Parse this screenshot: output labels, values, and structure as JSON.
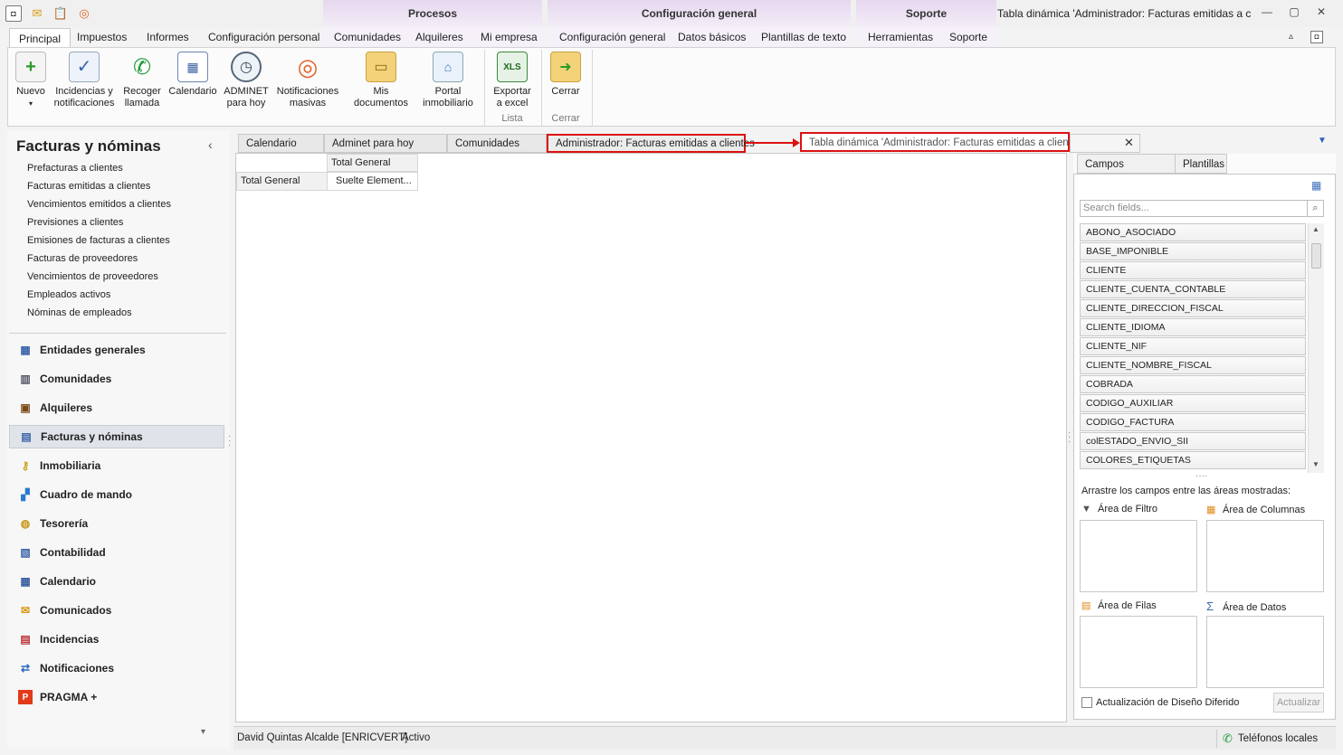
{
  "window": {
    "title": "Tabla dinámica 'Administrador: Facturas emitidas a client...",
    "contextual_groups": [
      "Procesos",
      "Configuración general",
      "Soporte"
    ]
  },
  "ribbon_tabs": [
    "Principal",
    "Impuestos",
    "Informes",
    "Configuración personal",
    "Comunidades",
    "Alquileres",
    "Mi empresa",
    "Configuración general",
    "Datos básicos",
    "Plantillas de texto",
    "Herramientas",
    "Soporte"
  ],
  "ribbon": {
    "buttons": [
      {
        "line1": "Nuevo",
        "line2": "▾"
      },
      {
        "line1": "Incidencias y",
        "line2": "notificaciones"
      },
      {
        "line1": "Recoger",
        "line2": "llamada"
      },
      {
        "line1": "Calendario",
        "line2": ""
      },
      {
        "line1": "ADMINET",
        "line2": "para hoy"
      },
      {
        "line1": "Notificaciones",
        "line2": "masivas"
      },
      {
        "line1": "Mis documentos",
        "line2": ""
      },
      {
        "line1": "Portal",
        "line2": "inmobiliario"
      },
      {
        "line1": "Exportar",
        "line2": "a excel"
      },
      {
        "line1": "Cerrar",
        "line2": ""
      }
    ],
    "group_labels": [
      "Lista",
      "Cerrar"
    ]
  },
  "nav": {
    "title": "Facturas y nóminas",
    "links": [
      "Prefacturas a clientes",
      "Facturas emitidas a clientes",
      "Vencimientos emitidos a clientes",
      "Previsiones a clientes",
      "Emisiones de facturas a clientes",
      "Facturas de proveedores",
      "Vencimientos de proveedores",
      "Empleados activos",
      "Nóminas de empleados"
    ],
    "modules": [
      "Entidades generales",
      "Comunidades",
      "Alquileres",
      "Facturas y nóminas",
      "Inmobiliaria",
      "Cuadro de mando",
      "Tesorería",
      "Contabilidad",
      "Calendario",
      "Comunicados",
      "Incidencias",
      "Notificaciones",
      "PRAGMA +"
    ],
    "active_module": "Facturas y nóminas"
  },
  "doc_tabs": [
    "Calendario",
    "Adminet para hoy",
    "Comunidades",
    "Administrador: Facturas emitidas a clientes",
    "Tabla dinámica 'Administrador: Facturas emitidas a clientes'"
  ],
  "pivot": {
    "col_header": "Total General",
    "row_header": "Total General",
    "value": "Suelte Element..."
  },
  "field_panel": {
    "tabs": [
      "Campos disponibles",
      "Plantillas"
    ],
    "search_placeholder": "Search fields...",
    "fields": [
      "ABONO_ASOCIADO",
      "BASE_IMPONIBLE",
      "CLIENTE",
      "CLIENTE_CUENTA_CONTABLE",
      "CLIENTE_DIRECCION_FISCAL",
      "CLIENTE_IDIOMA",
      "CLIENTE_NIF",
      "CLIENTE_NOMBRE_FISCAL",
      "COBRADA",
      "CODIGO_AUXILIAR",
      "CODIGO_FACTURA",
      "colESTADO_ENVIO_SII",
      "COLORES_ETIQUETAS"
    ],
    "drag_hint": "Arrastre los campos entre las áreas mostradas:",
    "areas": [
      "Área de Filtro",
      "Área de Columnas",
      "Área de Filas",
      "Área de Datos"
    ],
    "deferred_label": "Actualización de Diseño Diferido",
    "update_label": "Actualizar"
  },
  "status": {
    "user": "David Quintas Alcalde [ENRICVERT]",
    "state": "Activo",
    "phones": "Teléfonos locales"
  },
  "colors": {
    "highlight": "#dd1111",
    "context_group": "#e6d8ef"
  }
}
